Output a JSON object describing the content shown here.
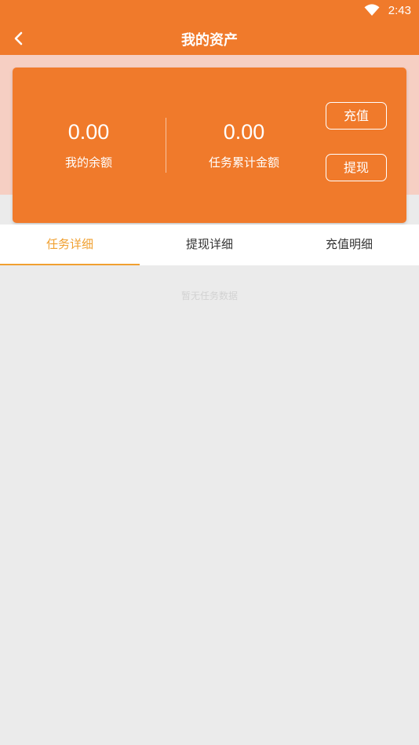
{
  "status_bar": {
    "time": "2:43",
    "icons": [
      "wifi-icon"
    ]
  },
  "app_bar": {
    "title": "我的资产",
    "back_icon": "chevron-left-icon"
  },
  "summary": {
    "balance": {
      "amount": "0.00",
      "label": "我的余额"
    },
    "task_total": {
      "amount": "0.00",
      "label": "任务累计金额"
    },
    "recharge_button": "充值",
    "withdraw_button": "提现"
  },
  "tabs": [
    {
      "label": "任务详细",
      "active": true
    },
    {
      "label": "提现详细",
      "active": false
    },
    {
      "label": "充值明细",
      "active": false
    }
  ],
  "empty_message": "暂无任务数据",
  "colors": {
    "primary": "#f07a2b",
    "accent": "#f0a030",
    "band": "#f6cfc3",
    "background": "#ebebeb"
  }
}
